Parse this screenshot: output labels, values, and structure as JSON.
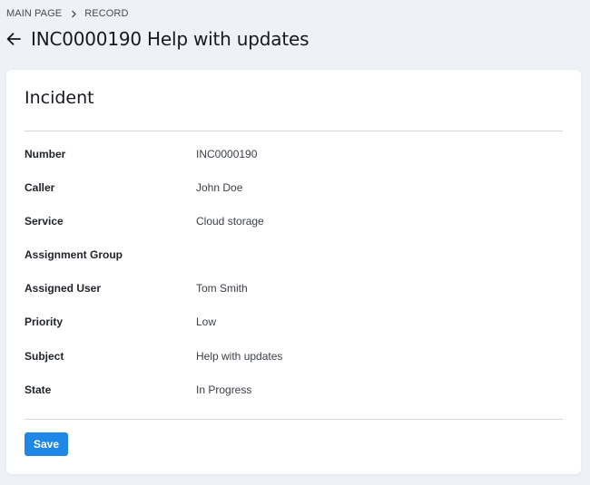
{
  "breadcrumb": {
    "items": [
      "MAIN PAGE",
      "RECORD"
    ]
  },
  "header": {
    "title": "INC0000190 Help with updates",
    "back_icon": "arrow-left-icon"
  },
  "card": {
    "title": "Incident",
    "fields": [
      {
        "label": "Number",
        "value": "INC0000190"
      },
      {
        "label": "Caller",
        "value": "John Doe"
      },
      {
        "label": "Service",
        "value": "Cloud storage"
      },
      {
        "label": "Assignment Group",
        "value": ""
      },
      {
        "label": "Assigned User",
        "value": "Tom Smith"
      },
      {
        "label": "Priority",
        "value": "Low"
      },
      {
        "label": "Subject",
        "value": "Help with updates"
      },
      {
        "label": "State",
        "value": "In Progress"
      }
    ],
    "save_label": "Save"
  },
  "colors": {
    "background": "#eef1f5",
    "card": "#ffffff",
    "accent": "#1f87e5"
  }
}
